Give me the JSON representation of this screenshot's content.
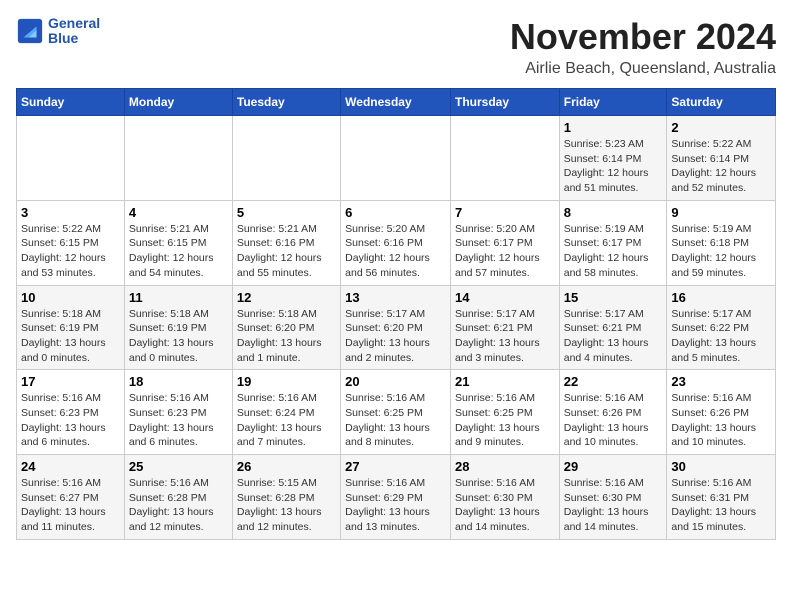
{
  "logo": {
    "line1": "General",
    "line2": "Blue"
  },
  "title": "November 2024",
  "location": "Airlie Beach, Queensland, Australia",
  "weekdays": [
    "Sunday",
    "Monday",
    "Tuesday",
    "Wednesday",
    "Thursday",
    "Friday",
    "Saturday"
  ],
  "weeks": [
    [
      {
        "day": "",
        "info": ""
      },
      {
        "day": "",
        "info": ""
      },
      {
        "day": "",
        "info": ""
      },
      {
        "day": "",
        "info": ""
      },
      {
        "day": "",
        "info": ""
      },
      {
        "day": "1",
        "info": "Sunrise: 5:23 AM\nSunset: 6:14 PM\nDaylight: 12 hours and 51 minutes."
      },
      {
        "day": "2",
        "info": "Sunrise: 5:22 AM\nSunset: 6:14 PM\nDaylight: 12 hours and 52 minutes."
      }
    ],
    [
      {
        "day": "3",
        "info": "Sunrise: 5:22 AM\nSunset: 6:15 PM\nDaylight: 12 hours and 53 minutes."
      },
      {
        "day": "4",
        "info": "Sunrise: 5:21 AM\nSunset: 6:15 PM\nDaylight: 12 hours and 54 minutes."
      },
      {
        "day": "5",
        "info": "Sunrise: 5:21 AM\nSunset: 6:16 PM\nDaylight: 12 hours and 55 minutes."
      },
      {
        "day": "6",
        "info": "Sunrise: 5:20 AM\nSunset: 6:16 PM\nDaylight: 12 hours and 56 minutes."
      },
      {
        "day": "7",
        "info": "Sunrise: 5:20 AM\nSunset: 6:17 PM\nDaylight: 12 hours and 57 minutes."
      },
      {
        "day": "8",
        "info": "Sunrise: 5:19 AM\nSunset: 6:17 PM\nDaylight: 12 hours and 58 minutes."
      },
      {
        "day": "9",
        "info": "Sunrise: 5:19 AM\nSunset: 6:18 PM\nDaylight: 12 hours and 59 minutes."
      }
    ],
    [
      {
        "day": "10",
        "info": "Sunrise: 5:18 AM\nSunset: 6:19 PM\nDaylight: 13 hours and 0 minutes."
      },
      {
        "day": "11",
        "info": "Sunrise: 5:18 AM\nSunset: 6:19 PM\nDaylight: 13 hours and 0 minutes."
      },
      {
        "day": "12",
        "info": "Sunrise: 5:18 AM\nSunset: 6:20 PM\nDaylight: 13 hours and 1 minute."
      },
      {
        "day": "13",
        "info": "Sunrise: 5:17 AM\nSunset: 6:20 PM\nDaylight: 13 hours and 2 minutes."
      },
      {
        "day": "14",
        "info": "Sunrise: 5:17 AM\nSunset: 6:21 PM\nDaylight: 13 hours and 3 minutes."
      },
      {
        "day": "15",
        "info": "Sunrise: 5:17 AM\nSunset: 6:21 PM\nDaylight: 13 hours and 4 minutes."
      },
      {
        "day": "16",
        "info": "Sunrise: 5:17 AM\nSunset: 6:22 PM\nDaylight: 13 hours and 5 minutes."
      }
    ],
    [
      {
        "day": "17",
        "info": "Sunrise: 5:16 AM\nSunset: 6:23 PM\nDaylight: 13 hours and 6 minutes."
      },
      {
        "day": "18",
        "info": "Sunrise: 5:16 AM\nSunset: 6:23 PM\nDaylight: 13 hours and 6 minutes."
      },
      {
        "day": "19",
        "info": "Sunrise: 5:16 AM\nSunset: 6:24 PM\nDaylight: 13 hours and 7 minutes."
      },
      {
        "day": "20",
        "info": "Sunrise: 5:16 AM\nSunset: 6:25 PM\nDaylight: 13 hours and 8 minutes."
      },
      {
        "day": "21",
        "info": "Sunrise: 5:16 AM\nSunset: 6:25 PM\nDaylight: 13 hours and 9 minutes."
      },
      {
        "day": "22",
        "info": "Sunrise: 5:16 AM\nSunset: 6:26 PM\nDaylight: 13 hours and 10 minutes."
      },
      {
        "day": "23",
        "info": "Sunrise: 5:16 AM\nSunset: 6:26 PM\nDaylight: 13 hours and 10 minutes."
      }
    ],
    [
      {
        "day": "24",
        "info": "Sunrise: 5:16 AM\nSunset: 6:27 PM\nDaylight: 13 hours and 11 minutes."
      },
      {
        "day": "25",
        "info": "Sunrise: 5:16 AM\nSunset: 6:28 PM\nDaylight: 13 hours and 12 minutes."
      },
      {
        "day": "26",
        "info": "Sunrise: 5:15 AM\nSunset: 6:28 PM\nDaylight: 13 hours and 12 minutes."
      },
      {
        "day": "27",
        "info": "Sunrise: 5:16 AM\nSunset: 6:29 PM\nDaylight: 13 hours and 13 minutes."
      },
      {
        "day": "28",
        "info": "Sunrise: 5:16 AM\nSunset: 6:30 PM\nDaylight: 13 hours and 14 minutes."
      },
      {
        "day": "29",
        "info": "Sunrise: 5:16 AM\nSunset: 6:30 PM\nDaylight: 13 hours and 14 minutes."
      },
      {
        "day": "30",
        "info": "Sunrise: 5:16 AM\nSunset: 6:31 PM\nDaylight: 13 hours and 15 minutes."
      }
    ]
  ]
}
